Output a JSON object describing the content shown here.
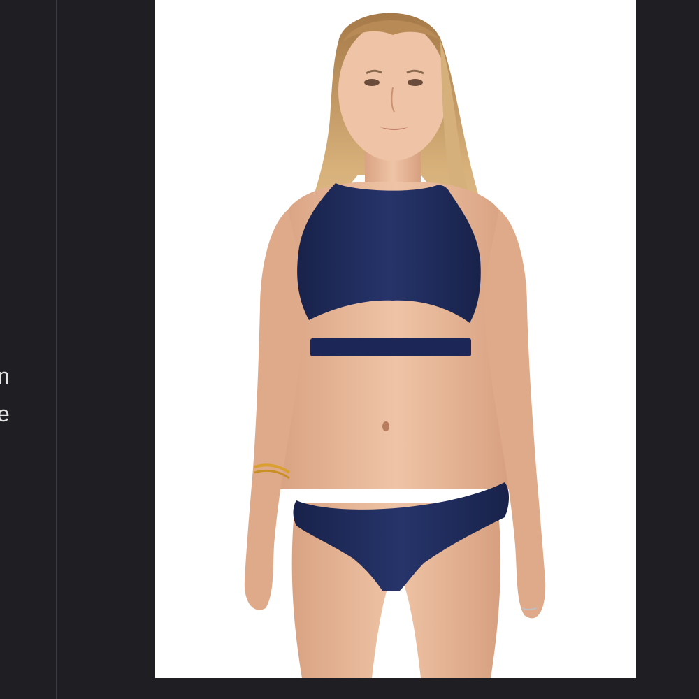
{
  "sidebar": {
    "partial_text": [
      "n",
      "e"
    ]
  },
  "viewer": {
    "image_subject": "product-photo-navy-bikini",
    "colors": {
      "background": "#1f1f23",
      "canvas": "#ffffff",
      "swimsuit": "#1e2a55",
      "skin": "#e9b99a",
      "hair": "#c9a066"
    }
  }
}
